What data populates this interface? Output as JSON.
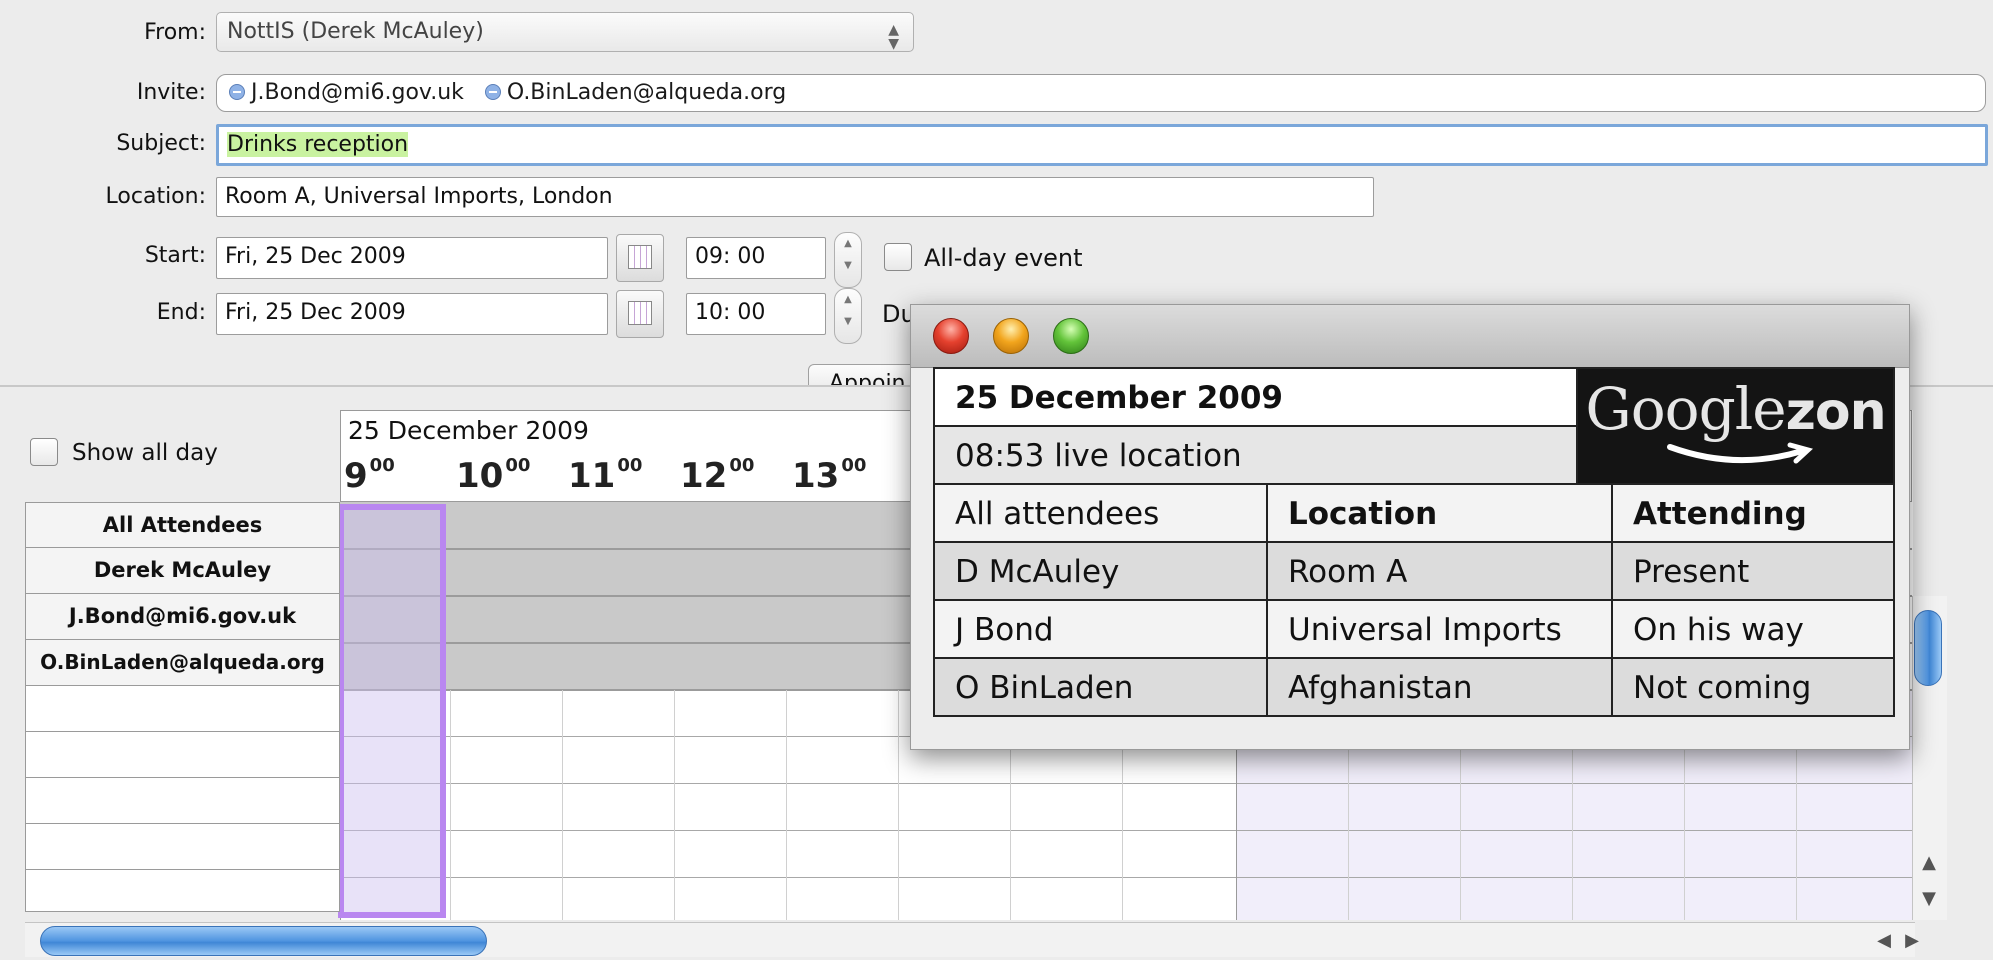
{
  "form": {
    "from_label": "From:",
    "from_value": "NottIS (Derek McAuley)",
    "invite_label": "Invite:",
    "invitees": [
      "J.Bond@mi6.gov.uk",
      "O.BinLaden@alqueda.org"
    ],
    "subject_label": "Subject:",
    "subject_value": "Drinks reception",
    "location_label": "Location:",
    "location_value": "Room A, Universal Imports, London",
    "start_label": "Start:",
    "start_date": "Fri, 25 Dec 2009",
    "start_time": "09: 00",
    "allday_label": "All-day event",
    "end_label": "End:",
    "end_date": "Fri, 25 Dec 2009",
    "end_time": "10: 00",
    "duration_label_partial": "Du",
    "appointment_button_partial": "Appoin"
  },
  "schedule": {
    "show_all_day_label": "Show all day",
    "date_header": "25 December 2009",
    "hours": [
      {
        "h": "9",
        "m": "00"
      },
      {
        "h": "10",
        "m": "00"
      },
      {
        "h": "11",
        "m": "00"
      },
      {
        "h": "12",
        "m": "00"
      },
      {
        "h": "13",
        "m": "00"
      }
    ],
    "attendees": [
      "All Attendees",
      "Derek McAuley",
      "J.Bond@mi6.gov.uk",
      "O.BinLaden@alqueda.org"
    ]
  },
  "popup": {
    "date": "25 December 2009",
    "live_location": "08:53 live location",
    "logo_text": "Google",
    "logo_suffix": "zon",
    "columns": [
      "All attendees",
      "Location",
      "Attending"
    ],
    "rows": [
      [
        "D McAuley",
        "Room A",
        "Present"
      ],
      [
        "J Bond",
        "Universal Imports",
        "On his way"
      ],
      [
        "O BinLaden",
        "Afghanistan",
        "Not coming"
      ]
    ]
  },
  "colors": {
    "subject_highlight": "#c9f2a0",
    "selection": "#b987f0",
    "scroll_accent": "#4f94e0"
  }
}
